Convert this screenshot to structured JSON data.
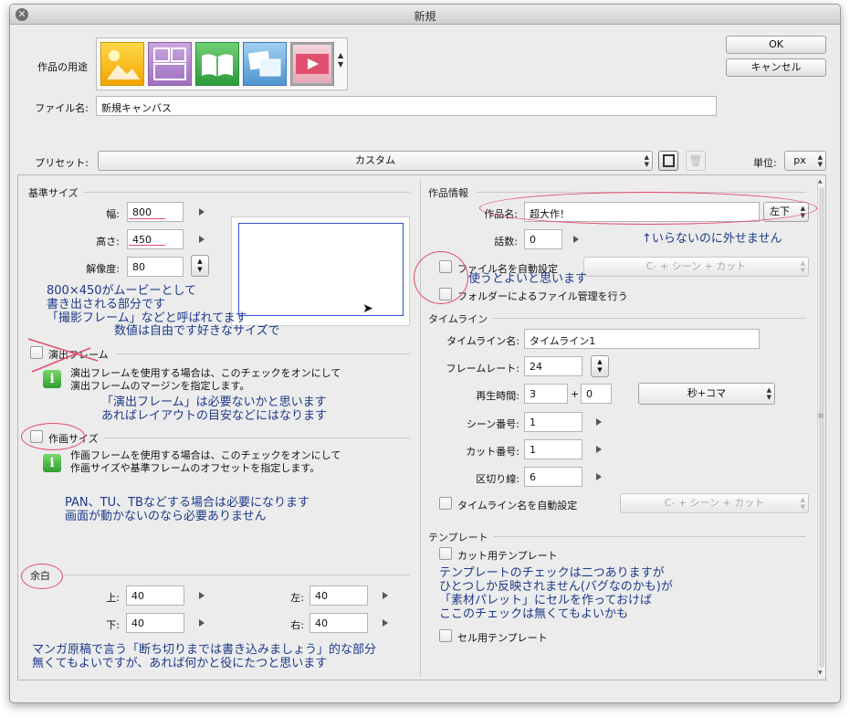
{
  "window": {
    "title": "新規"
  },
  "purpose": {
    "label": "作品の用途",
    "icons": [
      "illustration-icon",
      "comic-icon",
      "book-icon",
      "gallery-icon",
      "animation-icon"
    ]
  },
  "buttons": {
    "ok": "OK",
    "cancel": "キャンセル"
  },
  "file": {
    "label": "ファイル名:",
    "value": "新規キャンバス"
  },
  "preset": {
    "label": "プリセット:",
    "value": "カスタム"
  },
  "unit": {
    "label": "単位:",
    "value": "px"
  },
  "base_size": {
    "title": "基準サイズ",
    "width_label": "幅:",
    "width": "800",
    "height_label": "高さ:",
    "height": "450",
    "resolution_label": "解像度:",
    "resolution": "80"
  },
  "direction_frame": {
    "label": "演出フレーム",
    "info": "演出フレームを使用する場合は、このチェックをオンにして\n演出フレームのマージンを指定します。"
  },
  "canvas_size": {
    "label": "作画サイズ",
    "info": "作画フレームを使用する場合は、このチェックをオンにして\n作画サイズや基準フレームのオフセットを指定します。"
  },
  "margin": {
    "title": "余白",
    "top_label": "上:",
    "top": "40",
    "left_label": "左:",
    "left": "40",
    "bottom_label": "下:",
    "bottom": "40",
    "right_label": "右:",
    "right": "40"
  },
  "work_info": {
    "title": "作品情報",
    "name_label": "作品名:",
    "name": "超大作！",
    "position": "左下",
    "episode_label": "話数:",
    "episode": "0",
    "auto_filename_label": "ファイル名を自動設定",
    "auto_filename_popup": "C- + シーン + カット",
    "folder_manage_label": "フォルダーによるファイル管理を行う"
  },
  "timeline": {
    "title": "タイムライン",
    "name_label": "タイムライン名:",
    "name": "タイムライン1",
    "framerate_label": "フレームレート:",
    "framerate": "24",
    "duration_label": "再生時間:",
    "duration_sec": "3",
    "plus": "+",
    "duration_frames": "0",
    "duration_mode": "秒+コマ",
    "scene_label": "シーン番号:",
    "scene": "1",
    "cut_label": "カット番号:",
    "cut": "1",
    "divider_label": "区切り線:",
    "divider": "6",
    "auto_name_label": "タイムライン名を自動設定",
    "auto_name_popup": "C- + シーン + カット"
  },
  "template": {
    "title": "テンプレート",
    "cut_label": "カット用テンプレート",
    "cel_label": "セル用テンプレート"
  },
  "annotations": {
    "a1": "800×450がムービーとして\n書き出される部分です\n「撮影フレーム」などと呼ばれてます",
    "a2": "数値は自由です好きなサイズで",
    "a3": "「演出フレーム」は必要ないかと思います\nあればレイアウトの目安などにはなります",
    "a4": "PAN、TU、TBなどする場合は必要になります\n画面が動かないのなら必要ありません",
    "a5": "マンガ原稿で言う「断ち切りまでは書き込みましょう」的な部分\n無くてもよいですが、あれば何かと役にたつと思います",
    "a6": "↑いらないのに外せません",
    "a7": "使うとよいと思います",
    "a8": "テンプレートのチェックは二つありますが\nひとつしか反映されません(バグなのかも)が\n「素材パレット」にセルを作っておけば\nここのチェックは無くてもよいかも"
  },
  "colors": {
    "annotation_text": "#1d3a8a",
    "annotation_mark": "#e34d6b",
    "preview_border": "#2b4fd6"
  }
}
